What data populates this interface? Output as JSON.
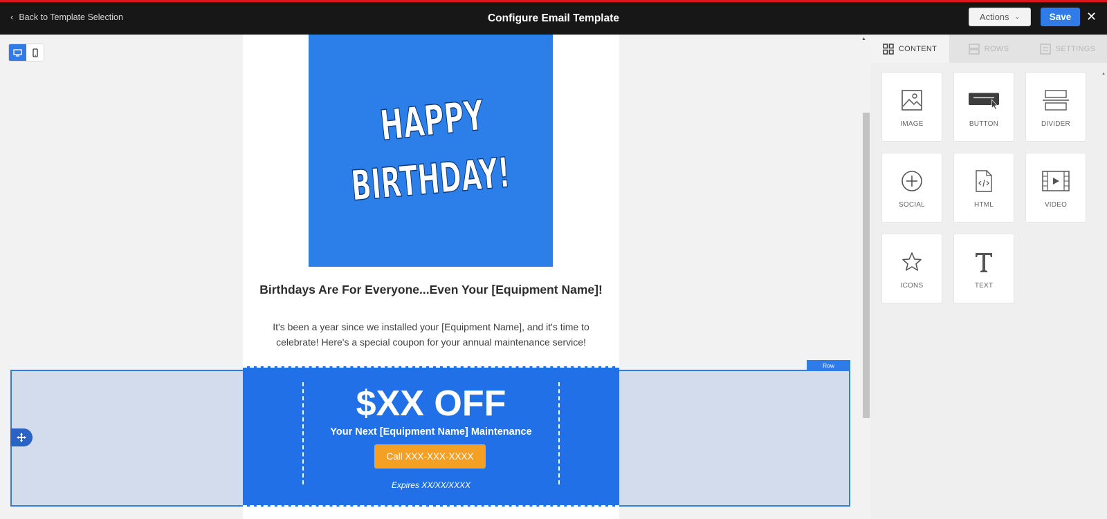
{
  "header": {
    "back_label": "Back to Template Selection",
    "title": "Configure Email Template",
    "actions_label": "Actions",
    "save_label": "Save"
  },
  "email": {
    "hero_text": "HAPPY BIRTHDAY!",
    "headline": "Birthdays Are For Everyone...Even Your [Equipment Name]!",
    "body": "It's been a year since we installed your [Equipment Name], and it's time to celebrate! Here's a special coupon for your annual maintenance service!"
  },
  "row": {
    "tag": "Row"
  },
  "coupon": {
    "discount": "$XX OFF",
    "subline": "Your Next [Equipment Name] Maintenance",
    "cta_label": "Call XXX-XXX-XXXX",
    "expires": "Expires XX/XX/XXXX"
  },
  "panel": {
    "tabs": [
      {
        "label": "CONTENT",
        "icon": "grid-icon"
      },
      {
        "label": "ROWS",
        "icon": "rows-icon"
      },
      {
        "label": "SETTINGS",
        "icon": "settings-icon"
      }
    ],
    "tiles": [
      {
        "label": "IMAGE",
        "icon": "image-icon"
      },
      {
        "label": "BUTTON",
        "icon": "button-icon"
      },
      {
        "label": "DIVIDER",
        "icon": "divider-icon"
      },
      {
        "label": "SOCIAL",
        "icon": "social-icon"
      },
      {
        "label": "HTML",
        "icon": "html-icon"
      },
      {
        "label": "VIDEO",
        "icon": "video-icon"
      },
      {
        "label": "ICONS",
        "icon": "star-icon"
      },
      {
        "label": "TEXT",
        "icon": "text-icon"
      }
    ]
  },
  "colors": {
    "accent": "#2f7be8",
    "coupon_bg": "#2170e8",
    "cta": "#f4a024",
    "topbar": "#171717",
    "topbar_stripe": "#e0151b"
  }
}
